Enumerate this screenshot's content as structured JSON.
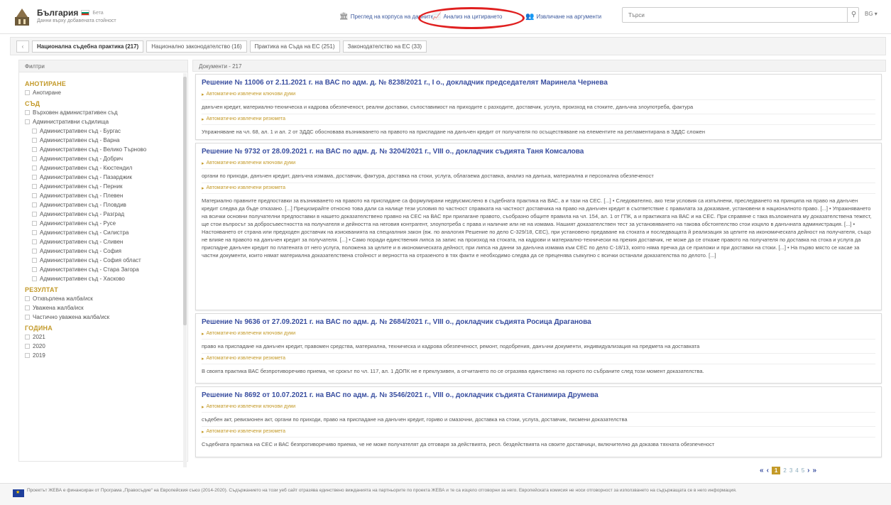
{
  "header": {
    "brand_title": "България",
    "brand_beta": "Бета",
    "brand_subtitle": "Данни върху добавената стойност",
    "nav": [
      {
        "label": "Преглед на корпуса на данните",
        "icon": "library-icon"
      },
      {
        "label": "Анализ на цитирането",
        "icon": "chart-icon"
      },
      {
        "label": "Извличане на аргументи",
        "icon": "people-icon"
      }
    ],
    "search_placeholder": "Търси",
    "lang": "BG ▾"
  },
  "tabs": [
    {
      "label": "Национална съдебна практика (217)",
      "active": true
    },
    {
      "label": "Национално законодателство (16)",
      "active": false
    },
    {
      "label": "Практика на Съда на ЕС (251)",
      "active": false
    },
    {
      "label": "Законодателство на ЕС (33)",
      "active": false
    }
  ],
  "filters": {
    "heading": "Филтри",
    "groups": [
      {
        "title": "АНОТИРАНЕ",
        "items": [
          {
            "label": "Анотиране",
            "indent": false
          }
        ]
      },
      {
        "title": "СЪД",
        "items": [
          {
            "label": "Върховен административен съд",
            "indent": false
          },
          {
            "label": "Административни съдилища",
            "indent": false
          },
          {
            "label": "Административен съд - Бургас",
            "indent": true
          },
          {
            "label": "Административен съд - Варна",
            "indent": true
          },
          {
            "label": "Административен съд - Велико Търново",
            "indent": true
          },
          {
            "label": "Административен съд - Добрич",
            "indent": true
          },
          {
            "label": "Административен съд - Кюстендил",
            "indent": true
          },
          {
            "label": "Административен съд - Пазарджик",
            "indent": true
          },
          {
            "label": "Административен съд - Перник",
            "indent": true
          },
          {
            "label": "Административен съд - Плевен",
            "indent": true
          },
          {
            "label": "Административен съд - Пловдив",
            "indent": true
          },
          {
            "label": "Административен съд - Разград",
            "indent": true
          },
          {
            "label": "Административен съд - Русе",
            "indent": true
          },
          {
            "label": "Административен съд - Силистра",
            "indent": true
          },
          {
            "label": "Административен съд - Сливен",
            "indent": true
          },
          {
            "label": "Административен съд - София",
            "indent": true
          },
          {
            "label": "Административен съд - София област",
            "indent": true
          },
          {
            "label": "Административен съд - Стара Загора",
            "indent": true
          },
          {
            "label": "Административен съд - Хасково",
            "indent": true
          }
        ]
      },
      {
        "title": "РЕЗУЛТАТ",
        "items": [
          {
            "label": "Отхвърлена жалба/иск",
            "indent": false
          },
          {
            "label": "Уважена жалба/иск",
            "indent": false
          },
          {
            "label": "Частично уважена жалба/иск",
            "indent": false
          }
        ]
      },
      {
        "title": "ГОДИНА",
        "items": [
          {
            "label": "2021",
            "indent": false
          },
          {
            "label": "2020",
            "indent": false
          },
          {
            "label": "2019",
            "indent": false
          }
        ]
      }
    ]
  },
  "results": {
    "heading": "Документи - 217",
    "kw_label": "Автоматично извлечени ключови думи",
    "excerpt_label": "Автоматично извлечени резюмета",
    "cards": [
      {
        "title": "Решение № 11006 от 2.11.2021 г. на ВАС по адм. д. № 8238/2021 г., I о., докладчик председателят Маринела Чернева",
        "keywords": "данъчен кредит, материално-техническа и кадрова обезпеченост, реални доставки, съпоставимост на приходите с разходите, доставчик, услуга, произход на стоките, данъчна злоупотреба, фактура",
        "excerpt": "Упражняване на чл. 68, ал. 1 и ал. 2 от ЗДДС обосновава възникването на правото на приспадане на данъчен кредит от получателя по осъществяване на елементите на регламентирана в ЗДДС сложен"
      },
      {
        "title": "Решение № 9732 от 28.09.2021 г. на ВАС по адм. д. № 3204/2021 г., VIII о., докладчик съдията Таня Комсалова",
        "keywords": "органи по приходи, данъчен кредит, данъчна измама, доставчик, фактура, доставка на стоки, услуга, облагаема доставка, анализ на данъка, материална и персонална обезпеченост",
        "excerpt": "Материално правните предпоставки за възникването на правото на приспадане са формулирани недвусмислено в съдебната практика на ВАС, а и тази на СЕС. [...] • Следователно, ако тези условия са изпълнени, преследването на принципа на право на данъчен кредит следва да бъде отказано. [...] Прецизирайте относно това дали са налице тези условия по частност справката на частност доставчика на право на данъчен кредит в съответствие с правилата за доказване, установени в националното право. [...] • Упражняването на всички основни получателни предпоставки в нашето доказателствено правно на СЕС на ВАС при прилагане правото, съобразно общите правила на чл. 154, ал. 1 от ГПК, а и практиката на ВАС и на СЕС. При справяне с така възложената му доказателствена тежест, ще стои въпросът за добросъвестността на получателя и дейността на неговия контрагент, злоупотреба с права и наличие или не на измама. Нашият доказателствен тест за установяването на такова обстоятелство стои изцяло в данъчната администрация. [...] • Настояването от страна или предходен доставчик на изискванията на специалния закон (вж. по аналогия Решение по дело C-329/18, СЕС), при установено предаване на стоката и последващата й реализация за целите на икономическата дейност на получателя, също не влияе на правото на данъчен кредит за получателя. [...] • Само поради единствения липса за запис на произход на стоката, на кадрови и материално-технически на прекия доставчик, не може да се откаже правото на получателя по доставка на стока и услуга да приспадне данъчен кредит по платената от него услуга, положена за целите и в икономическата дейност, при липса на данни за данъчна измама към СЕС по дело C-18/13, която няма пречка да се приложи и при доставки на стоки. [...] • На първо място се касае за частни документи, които нямат материална доказателствена стойност и верността на отразеното в тях факти е необходимо следва да се преценява съвкупно с всички останали доказателства по делото. [...]"
      },
      {
        "title": "Решение № 9636 от 27.09.2021 г. на ВАС по адм. д. № 2684/2021 г., VIII о., докладчик съдията Росица Драганова",
        "keywords": "право на приспадане на данъчен кредит, правомен средства, материална, техническа и кадрова обезпеченост, ремонт, подобрения, данъчни документи, индивидуализация на предмета на доставката",
        "excerpt": "В своята практика ВАС безпротиворечиво приема, че срокът по чл. 117, ал. 1 ДОПК не е преклузивен, а отчитането по се отразява единствено на горното по събраните след този момент доказателства."
      },
      {
        "title": "Решение № 8692 от 10.07.2021 г. на ВАС по адм. д. № 3546/2021 г., VIII о., докладчик съдията Станимира Друмева",
        "keywords": "съдебен акт, ревизионен акт, органи по приходи, право на приспадане на данъчен кредит, гориво и смазочни, доставка на стоки, услуга, доставчик, писмени доказателства",
        "excerpt": "Съдебната практика на СЕС и ВАС безпротиворечиво приема, че не може получателят да отговаря за действията, респ. бездействията на своите доставчици, включително да доказва тяхната обезпеченост"
      }
    ]
  },
  "pager": {
    "first": "«",
    "prev": "‹",
    "pages": [
      "1",
      "2",
      "3",
      "4",
      "5"
    ],
    "next": "›",
    "last": "»"
  },
  "footer": {
    "text": "Проектът ЖЕВА е финансиран от Програма „Правосъдие“ на Европейския съюз (2014-2020). Съдържанието на този уеб сайт отразява единствено вижданията на партньорите по проекта ЖЕВА и те са изцяло отговорни за него. Европейската комисия не носи отговорност за използването на съдържащата се в него информация."
  },
  "colors": {
    "accent": "#c49a28",
    "link": "#3a4fa0",
    "highlight": "#e02020"
  }
}
